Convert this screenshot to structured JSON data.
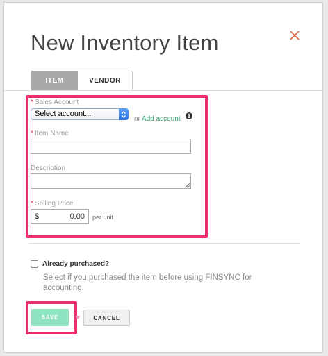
{
  "dialog": {
    "title": "New Inventory Item",
    "close_icon": "close-icon"
  },
  "tabs": [
    {
      "label": "ITEM",
      "active": true
    },
    {
      "label": "VENDOR",
      "active": false
    }
  ],
  "form": {
    "sales_account": {
      "label": "Sales Account",
      "required": true,
      "selected": "Select account...",
      "or_text": "or",
      "add_link": "Add account",
      "info_icon": "i"
    },
    "item_name": {
      "label": "Item Name",
      "required": true,
      "value": ""
    },
    "description": {
      "label": "Description",
      "required": false,
      "value": ""
    },
    "selling_price": {
      "label": "Selling Price",
      "required": true,
      "currency": "$",
      "value": "0.00",
      "unit_text": "per unit"
    }
  },
  "purchased": {
    "label": "Already purchased?",
    "checked": false,
    "help": "Select if you purchased the item before using FINSYNC for accounting."
  },
  "actions": {
    "save_label": "SAVE",
    "cancel_label": "CANCEL"
  },
  "colors": {
    "highlight": "#e8306b",
    "accent_green": "#2e9a6a",
    "save_bg": "#8ee3c0",
    "close_x": "#e0603c"
  }
}
